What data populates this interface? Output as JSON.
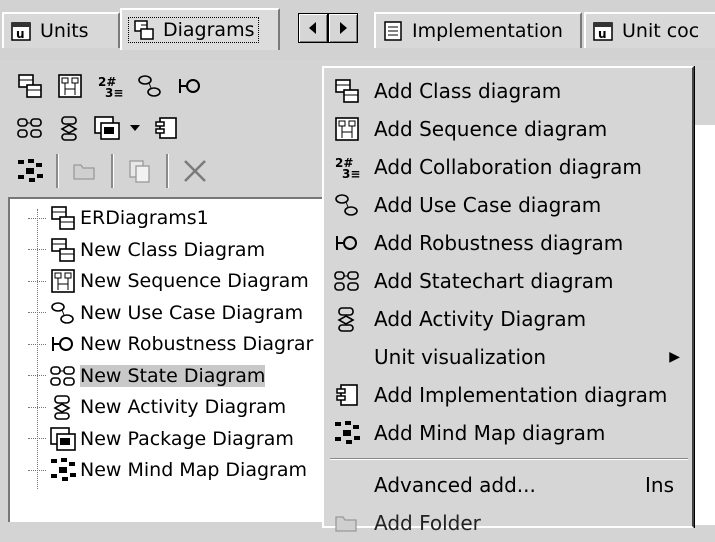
{
  "tabs": {
    "units": "Units",
    "diagrams": "Diagrams",
    "implementation": "Implementation",
    "unit_code": "Unit coc"
  },
  "tree": {
    "items": [
      {
        "label": "ERDiagrams1",
        "icon": "class-diagram-icon"
      },
      {
        "label": "New Class Diagram",
        "icon": "class-diagram-icon"
      },
      {
        "label": "New Sequence Diagram",
        "icon": "sequence-diagram-icon"
      },
      {
        "label": "New Use Case Diagram",
        "icon": "use-case-diagram-icon"
      },
      {
        "label": "New Robustness Diagrar",
        "icon": "robustness-diagram-icon"
      },
      {
        "label": "New State Diagram",
        "icon": "statechart-diagram-icon",
        "selected": true
      },
      {
        "label": "New Activity Diagram",
        "icon": "activity-diagram-icon"
      },
      {
        "label": "New Package Diagram",
        "icon": "package-diagram-icon"
      },
      {
        "label": "New Mind Map Diagram",
        "icon": "mind-map-diagram-icon"
      }
    ]
  },
  "menu": {
    "items": [
      {
        "label": "Add Class diagram",
        "icon": "class-diagram-icon"
      },
      {
        "label": "Add Sequence diagram",
        "icon": "sequence-diagram-icon"
      },
      {
        "label": "Add Collaboration diagram",
        "icon": "collaboration-diagram-icon"
      },
      {
        "label": "Add Use Case diagram",
        "icon": "use-case-diagram-icon"
      },
      {
        "label": "Add Robustness diagram",
        "icon": "robustness-diagram-icon"
      },
      {
        "label": "Add Statechart diagram",
        "icon": "statechart-diagram-icon"
      },
      {
        "label": "Add Activity Diagram",
        "icon": "activity-diagram-icon"
      },
      {
        "label": "Unit visualization",
        "icon": "",
        "submenu": true
      },
      {
        "label": "Add Implementation diagram",
        "icon": "implementation-diagram-icon"
      },
      {
        "label": "Add Mind Map diagram",
        "icon": "mind-map-diagram-icon"
      }
    ],
    "advanced_add": "Advanced add...",
    "advanced_add_shortcut": "Ins",
    "add_folder": "Add Folder"
  }
}
